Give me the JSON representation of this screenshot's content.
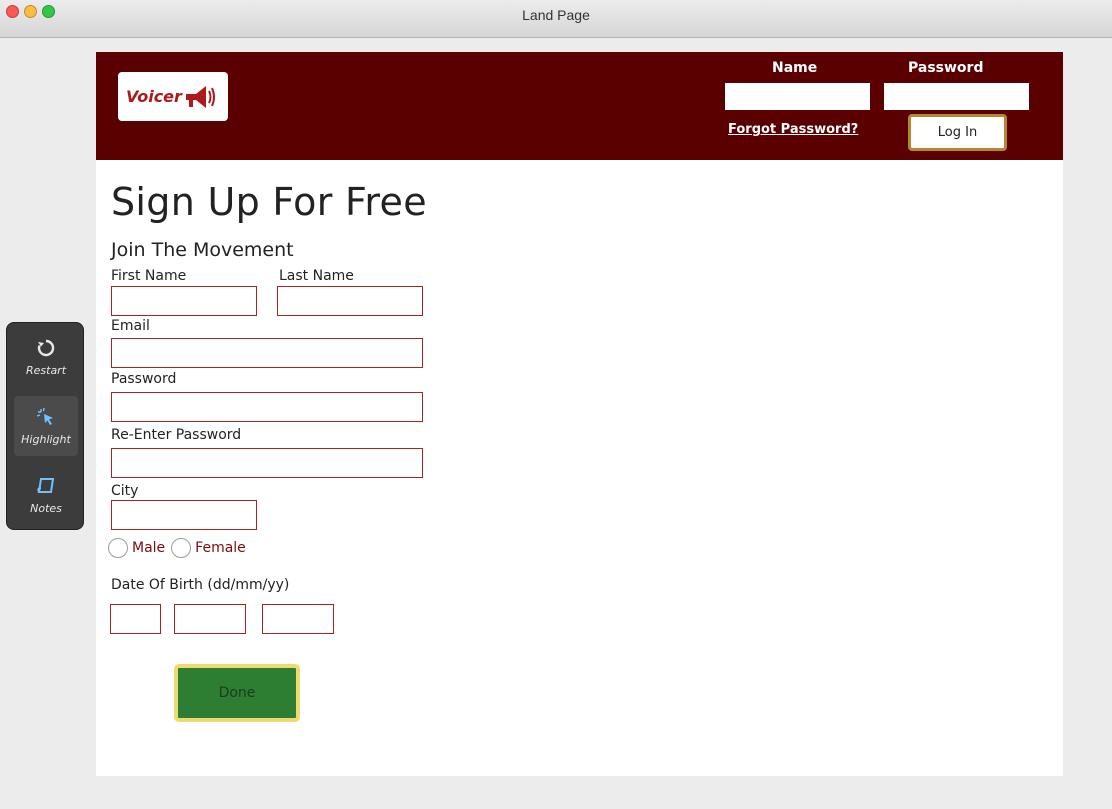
{
  "window": {
    "title": "Land Page"
  },
  "header": {
    "logo_text": "Voicer",
    "name_label": "Name",
    "password_label": "Password",
    "forgot_password": "Forgot Password?",
    "login_label": "Log In"
  },
  "form": {
    "title": "Sign Up For Free",
    "subtitle": "Join The Movement",
    "first_name_label": "First Name",
    "last_name_label": "Last Name",
    "email_label": "Email",
    "password_label": "Password",
    "reenter_password_label": "Re-Enter Password",
    "city_label": "City",
    "gender_options": [
      "Male",
      "Female"
    ],
    "dob_label": "Date Of Birth (dd/mm/yy)",
    "done_label": "Done"
  },
  "toolbar": {
    "items": [
      {
        "label": "Restart",
        "icon": "refresh-icon"
      },
      {
        "label": "Highlight",
        "icon": "cursor-sparkle-icon"
      },
      {
        "label": "Notes",
        "icon": "note-icon"
      }
    ]
  },
  "colors": {
    "header_bg": "#5a0000",
    "field_border": "#a32626",
    "done_bg": "#2d7d33",
    "done_border": "#f0d96d",
    "login_border": "#b8862b"
  }
}
